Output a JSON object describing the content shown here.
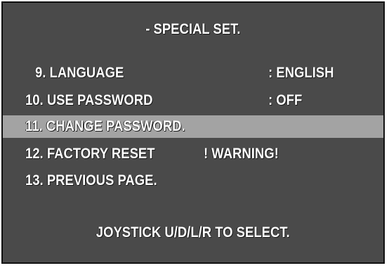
{
  "title": "- SPECIAL SET.",
  "menu": {
    "items": [
      {
        "label": "9. LANGUAGE",
        "value": ": ENGLISH"
      },
      {
        "label": "10. USE PASSWORD",
        "value": ": OFF"
      },
      {
        "label": "11. CHANGE PASSWORD.",
        "selected": true
      },
      {
        "label": "12. FACTORY RESET",
        "warning": "! WARNING!"
      },
      {
        "label": "13. PREVIOUS PAGE."
      }
    ]
  },
  "footer": "JOYSTICK U/D/L/R TO SELECT.",
  "colors": {
    "background": "#4a4a4a",
    "highlight": "#a3a3a3",
    "text": "#ffffff"
  }
}
